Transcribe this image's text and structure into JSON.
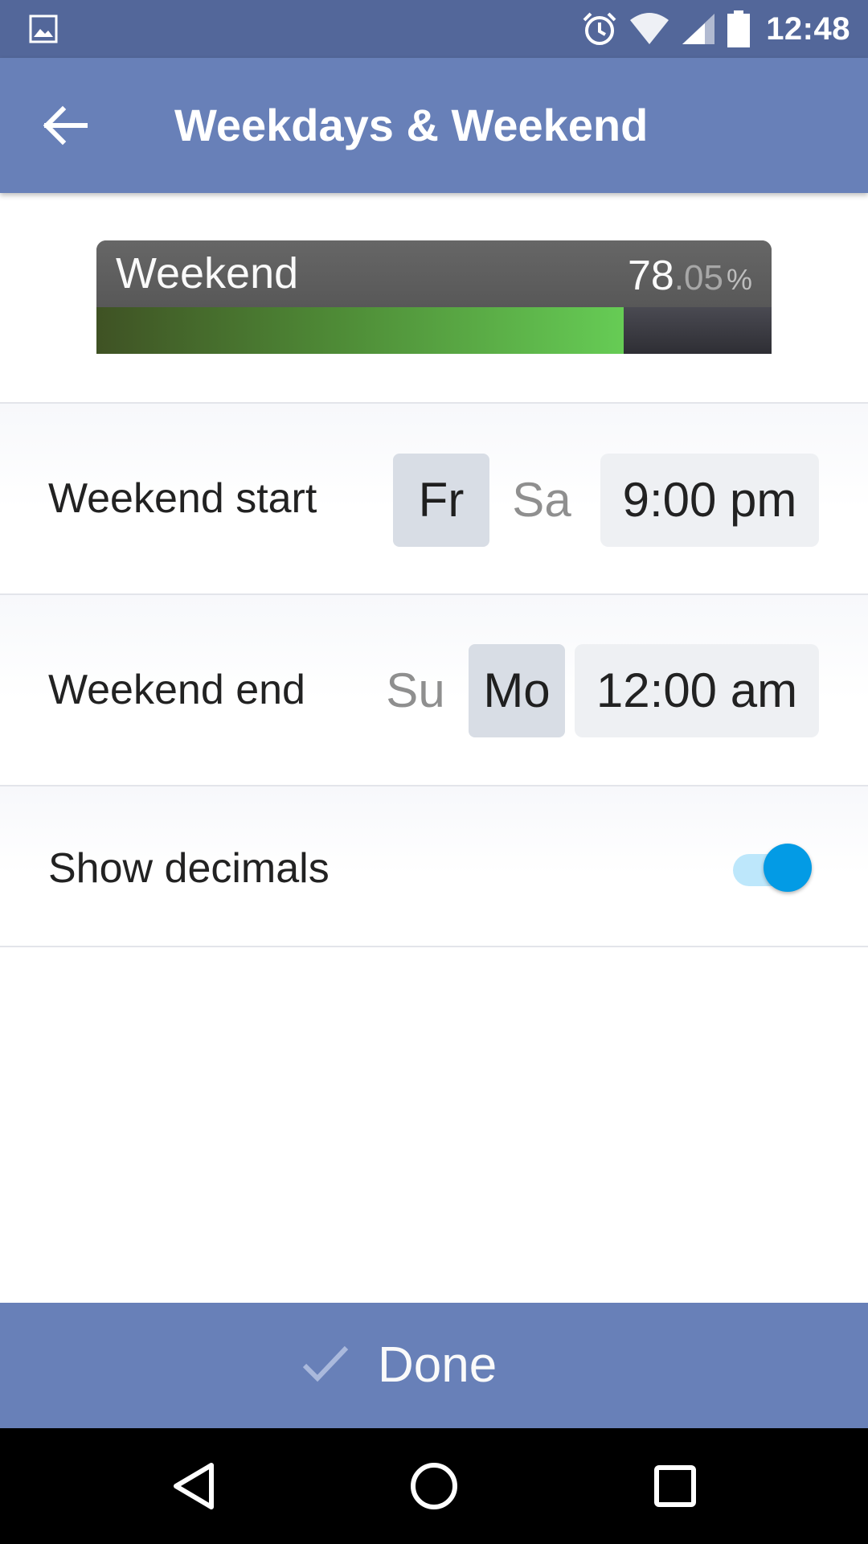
{
  "status_bar": {
    "time": "12:48",
    "icons": [
      "gallery-icon",
      "alarm-icon",
      "wifi-icon",
      "signal-icon",
      "battery-icon"
    ]
  },
  "app_bar": {
    "title": "Weekdays & Weekend",
    "back_icon": "arrow-left-icon"
  },
  "progress": {
    "label": "Weekend",
    "percent_int": "78",
    "percent_dec": ".05",
    "percent_symbol": "%",
    "value_percent": 78.05
  },
  "weekend_start": {
    "label": "Weekend start",
    "days": [
      {
        "label": "Fr",
        "selected": true
      },
      {
        "label": "Sa",
        "selected": false
      }
    ],
    "time": "9:00 pm"
  },
  "weekend_end": {
    "label": "Weekend end",
    "days": [
      {
        "label": "Su",
        "selected": false
      },
      {
        "label": "Mo",
        "selected": true
      }
    ],
    "time": "12:00 am"
  },
  "show_decimals": {
    "label": "Show decimals",
    "enabled": true
  },
  "done_button": {
    "label": "Done",
    "icon": "check-icon"
  },
  "nav_bar": {
    "icons": [
      "back-triangle-icon",
      "home-circle-icon",
      "recents-square-icon"
    ]
  },
  "colors": {
    "status_bar": "#53679a",
    "app_bar": "#6880b8",
    "toggle_on": "#039be5",
    "progress_fill": "#66cc55"
  }
}
